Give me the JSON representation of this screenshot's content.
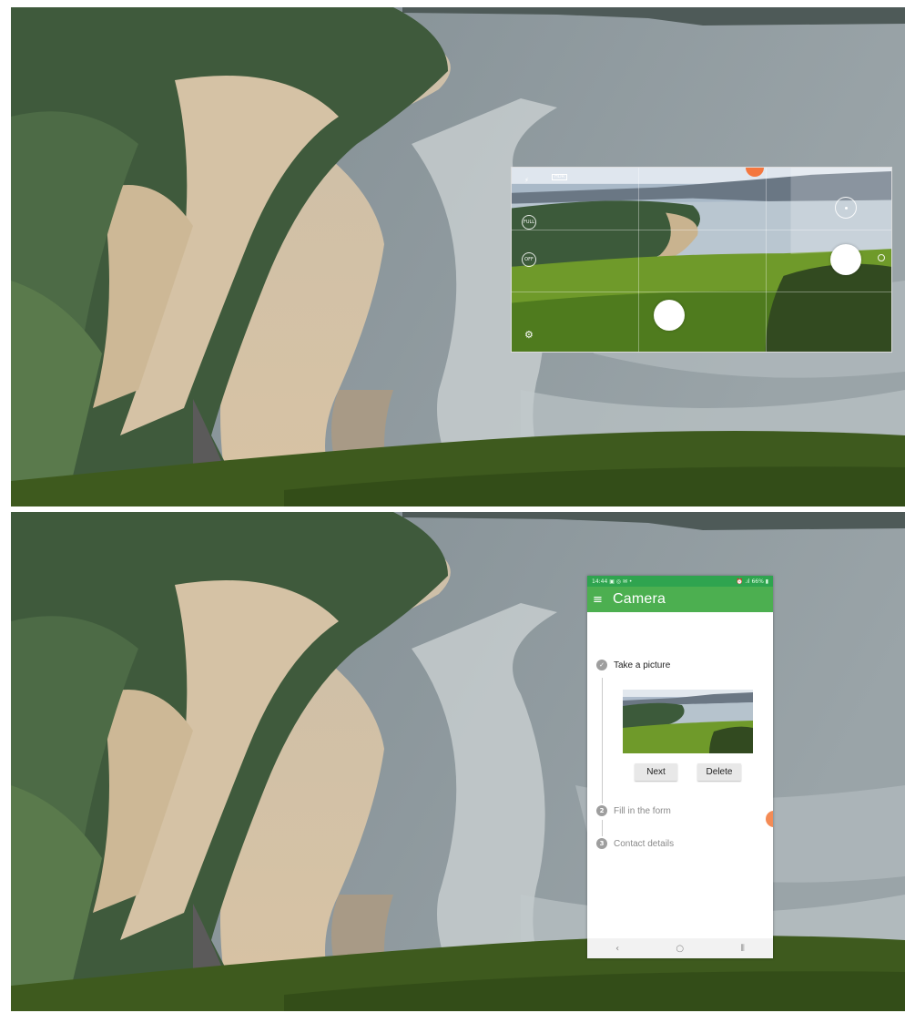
{
  "camera_preview": {
    "hdr_label": "HDR",
    "full_label": "FULL",
    "timer_label": "OFF",
    "icons": [
      "flash-off-icon",
      "hdr-icon",
      "aspect-full-icon",
      "timer-off-icon",
      "settings-icon",
      "switch-camera-icon",
      "shutter-icon"
    ]
  },
  "phone": {
    "status_bar": {
      "time": "14:44",
      "left_icons": "▣ ◎ ✉ •",
      "right": "⏰ .ıl 66% ▮"
    },
    "app_bar": {
      "menu_icon": "≡",
      "title": "Camera"
    },
    "steps": [
      {
        "index": "✓",
        "label": "Take a picture",
        "state": "active"
      },
      {
        "index": "2",
        "label": "Fill in the form",
        "state": "inactive"
      },
      {
        "index": "3",
        "label": "Contact details",
        "state": "inactive"
      }
    ],
    "buttons": {
      "next": "Next",
      "delete": "Delete"
    },
    "nav": {
      "back": "‹",
      "home": "○",
      "recents": "⦀"
    }
  },
  "colors": {
    "app_bar": "#4caf50",
    "status_bar": "#2fa44f",
    "accent_orange": "#f4773f"
  }
}
